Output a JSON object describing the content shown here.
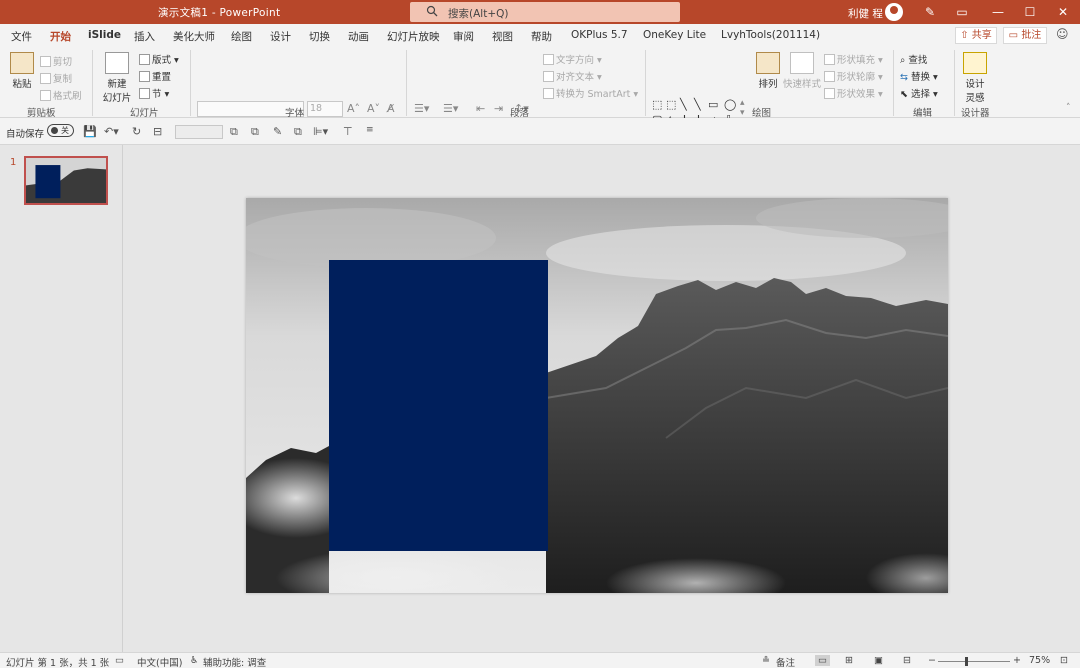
{
  "window": {
    "title": "演示文稿1  -  PowerPoint",
    "search_placeholder": "搜索(Alt+Q)",
    "user_name": "利健 程"
  },
  "tabs": [
    "文件",
    "开始",
    "iSlide",
    "插入",
    "美化大师",
    "绘图",
    "设计",
    "切换",
    "动画",
    "幻灯片放映",
    "审阅",
    "视图",
    "帮助",
    "OKPlus 5.7",
    "OneKey Lite",
    "LvyhTools(201114)"
  ],
  "active_tab": "开始",
  "share_label": "共享",
  "comment_label": "批注",
  "ribbon": {
    "clipboard": {
      "paste": "粘贴",
      "cut": "剪切",
      "copy": "复制",
      "format_painter": "格式刷",
      "label": "剪贴板"
    },
    "slides": {
      "new_slide_1": "新建",
      "new_slide_2": "幻灯片",
      "layout": "版式",
      "reset": "重置",
      "section": "节",
      "label": "幻灯片"
    },
    "font": {
      "size_value": "18",
      "label": "字体"
    },
    "paragraph": {
      "text_direction": "文字方向",
      "align_text": "对齐文本",
      "smartart": "转换为 SmartArt",
      "label": "段落"
    },
    "drawing": {
      "arrange": "排列",
      "quick_styles": "快速样式",
      "shape_fill": "形状填充",
      "shape_outline": "形状轮廓",
      "shape_effects": "形状效果",
      "label": "绘图"
    },
    "editing": {
      "find": "查找",
      "replace": "替换",
      "select": "选择",
      "label": "编辑"
    },
    "designer": {
      "design_ideas_1": "设计",
      "design_ideas_2": "灵感",
      "label": "设计器"
    }
  },
  "qat": {
    "autosave_label": "自动保存",
    "autosave_state": "关"
  },
  "thumbnails": [
    {
      "number": "1"
    }
  ],
  "slide": {
    "background": "grayscale mountain photo",
    "shape_color": "#001f5c"
  },
  "status": {
    "slide_info": "幻灯片 第 1 张，共 1 张",
    "language": "中文(中国)",
    "accessibility": "辅助功能: 调查",
    "notes": "备注",
    "zoom": "75%"
  },
  "colors": {
    "accent": "#b7472a",
    "shape": "#001f5c"
  }
}
